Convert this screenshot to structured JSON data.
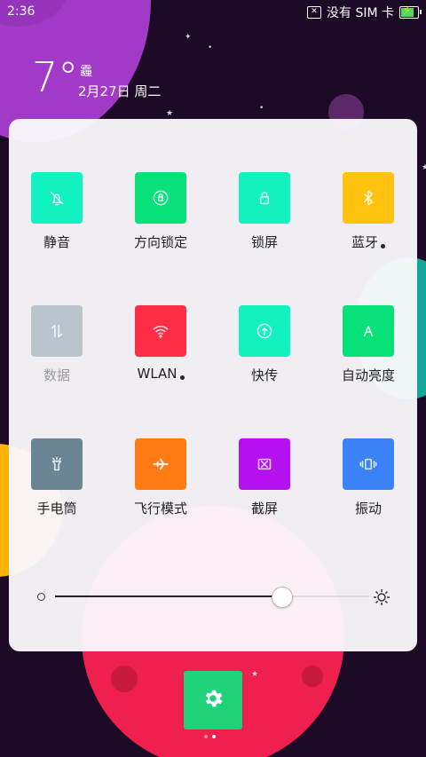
{
  "status_bar": {
    "time": "2:36",
    "sim_text": "没有 SIM 卡"
  },
  "weather": {
    "temperature": "7°",
    "condition": "霾",
    "date": "2月27日 周二"
  },
  "tiles": [
    {
      "label": "静音",
      "icon": "bell-off-icon",
      "color": "#12f2c0",
      "dot": false,
      "dim": false
    },
    {
      "label": "方向锁定",
      "icon": "rotation-lock-icon",
      "color": "#08e07a",
      "dot": false,
      "dim": false
    },
    {
      "label": "锁屏",
      "icon": "lock-icon",
      "color": "#12f2c0",
      "dot": false,
      "dim": false
    },
    {
      "label": "蓝牙",
      "icon": "bluetooth-icon",
      "color": "#ffc20e",
      "dot": true,
      "dim": false
    },
    {
      "label": "数据",
      "icon": "data-arrows-icon",
      "color": "#b7c4cc",
      "dot": false,
      "dim": true
    },
    {
      "label": "WLAN",
      "icon": "wifi-icon",
      "color": "#ff2d45",
      "dot": true,
      "dim": false
    },
    {
      "label": "快传",
      "icon": "upload-circle-icon",
      "color": "#12f2c0",
      "dot": false,
      "dim": false
    },
    {
      "label": "自动亮度",
      "icon": "auto-brightness-icon",
      "color": "#08e07a",
      "dot": false,
      "dim": false
    },
    {
      "label": "手电筒",
      "icon": "flashlight-icon",
      "color": "#6c8595",
      "dot": false,
      "dim": false
    },
    {
      "label": "飞行模式",
      "icon": "airplane-icon",
      "color": "#ff7a12",
      "dot": false,
      "dim": false
    },
    {
      "label": "截屏",
      "icon": "screenshot-icon",
      "color": "#b511f0",
      "dot": false,
      "dim": false
    },
    {
      "label": "振动",
      "icon": "vibrate-icon",
      "color": "#3b82f6",
      "dot": false,
      "dim": false
    }
  ],
  "brightness": {
    "level": 0.72
  },
  "settings": {
    "icon": "gear-icon",
    "color": "#1fd27a"
  },
  "pager": {
    "pages": 2,
    "current": 2
  }
}
